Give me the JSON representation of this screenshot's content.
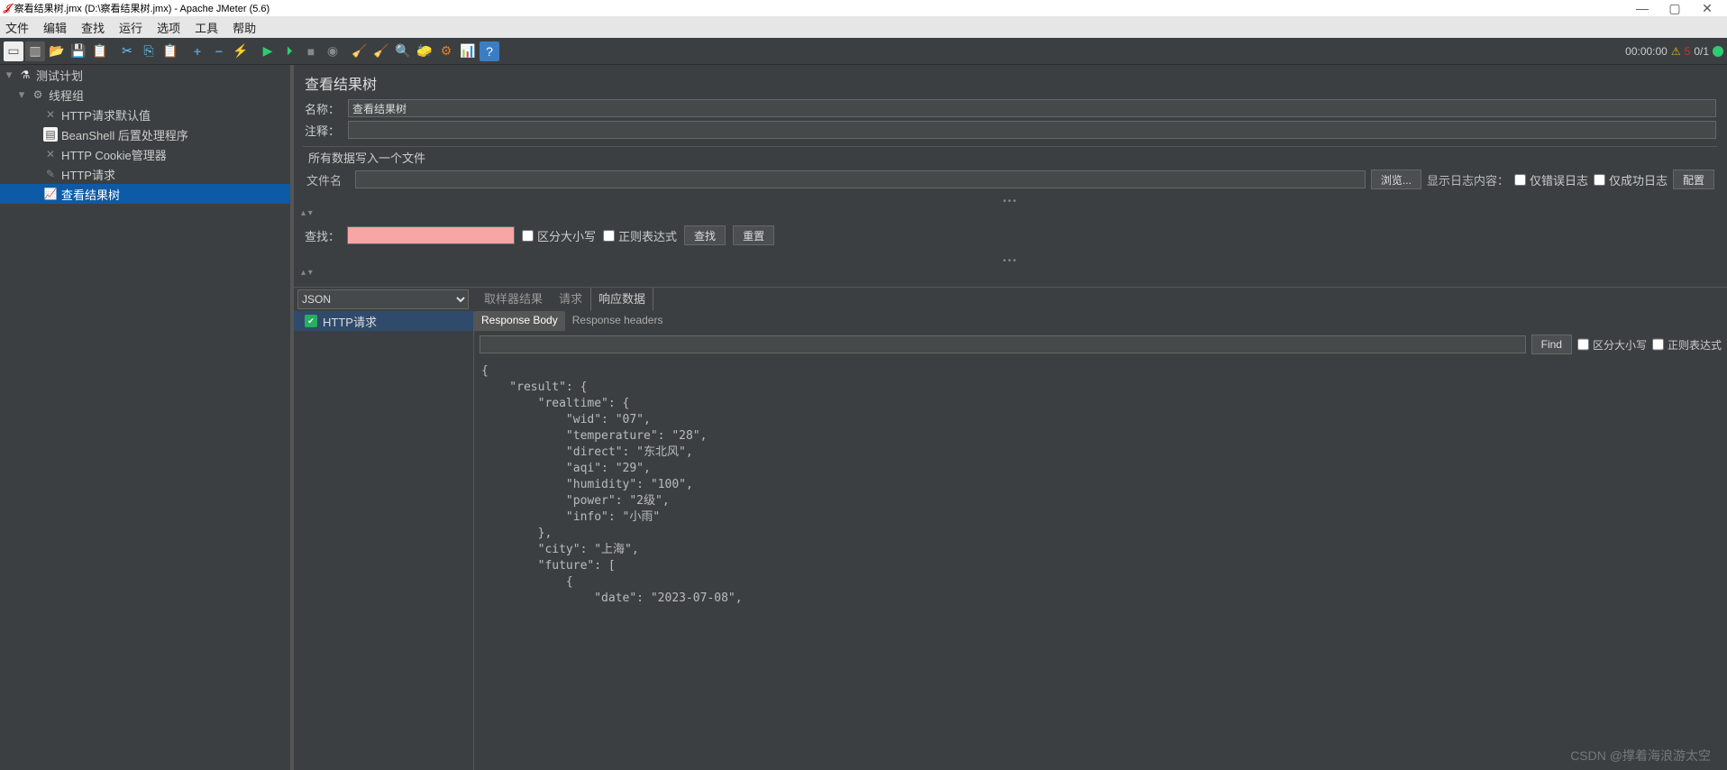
{
  "title_bar": {
    "text": "察看结果树.jmx (D:\\察看结果树.jmx) - Apache JMeter (5.6)"
  },
  "menu": [
    "文件",
    "编辑",
    "查找",
    "运行",
    "选项",
    "工具",
    "帮助"
  ],
  "status": {
    "time": "00:00:00",
    "errors": "5",
    "ratio": "0/1"
  },
  "tree": {
    "root": "测试计划",
    "group": "线程组",
    "items": [
      "HTTP请求默认值",
      "BeanShell 后置处理程序",
      "HTTP Cookie管理器",
      "HTTP请求",
      "查看结果树"
    ]
  },
  "panel": {
    "title": "查看结果树",
    "name_label": "名称：",
    "name_value": "查看结果树",
    "comment_label": "注释：",
    "file_header": "所有数据写入一个文件",
    "file_label": "文件名",
    "browse": "浏览...",
    "show_log": "显示日志内容：",
    "only_err": "仅错误日志",
    "only_ok": "仅成功日志",
    "config": "配置"
  },
  "search": {
    "label": "查找：",
    "case": "区分大小写",
    "regex": "正则表达式",
    "find": "查找",
    "reset": "重置"
  },
  "result": {
    "format": "JSON",
    "tabs": [
      "取样器结果",
      "请求",
      "响应数据"
    ],
    "active_tab": 2,
    "sample": "HTTP请求",
    "sub_tabs": [
      "Response Body",
      "Response headers"
    ],
    "find": "Find",
    "find_case": "区分大小写",
    "find_regex": "正则表达式"
  },
  "json_body": "{\n    \"result\": {\n        \"realtime\": {\n            \"wid\": \"07\",\n            \"temperature\": \"28\",\n            \"direct\": \"东北风\",\n            \"aqi\": \"29\",\n            \"humidity\": \"100\",\n            \"power\": \"2级\",\n            \"info\": \"小雨\"\n        },\n        \"city\": \"上海\",\n        \"future\": [\n            {\n                \"date\": \"2023-07-08\",",
  "watermark": "CSDN @撑着海浪游太空"
}
